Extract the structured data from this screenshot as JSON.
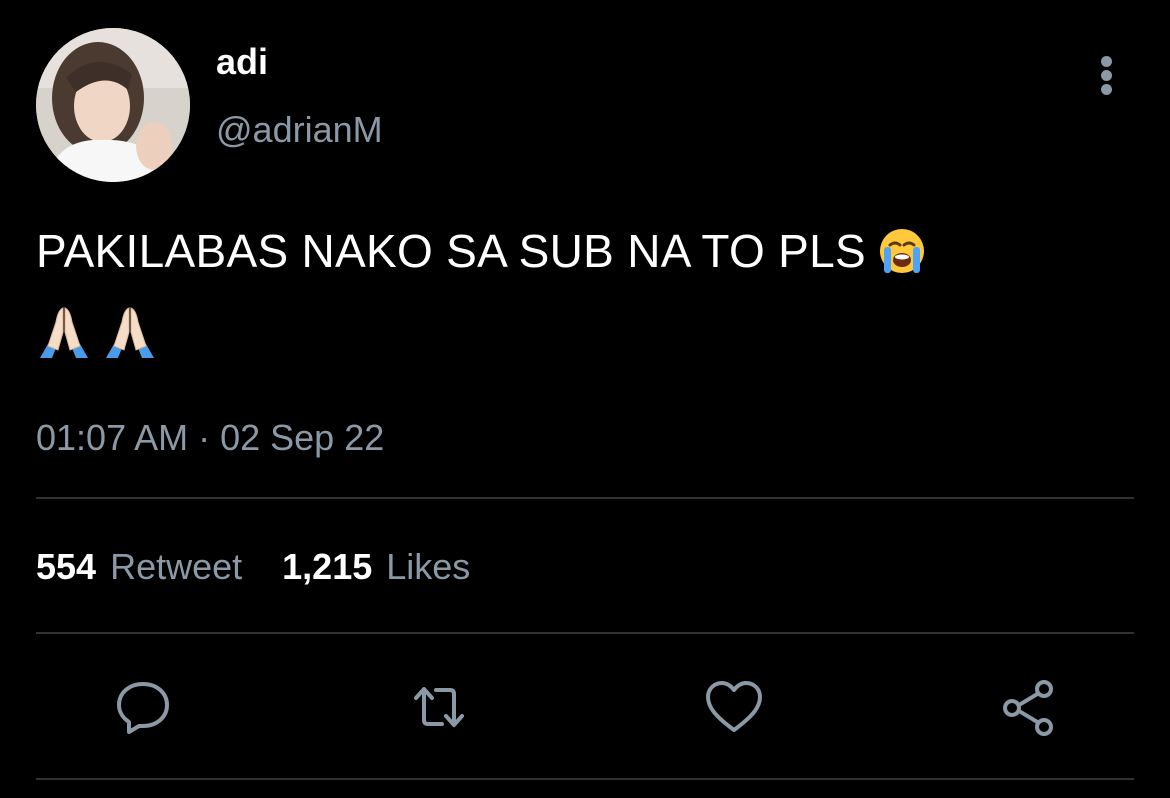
{
  "tweet": {
    "display_name": "adi",
    "handle": "@adrianM",
    "text": "PAKILABAS NAKO SA SUB NA TO PLS",
    "text_emoji": "loudly-crying-face",
    "second_line_emojis": [
      "folded-hands",
      "folded-hands"
    ],
    "timestamp": "01:07 AM · 02 Sep 22"
  },
  "stats": {
    "retweets_count": "554",
    "retweets_label": "Retweet",
    "likes_count": "1,215",
    "likes_label": "Likes"
  },
  "actions": [
    "reply-icon",
    "retweet-icon",
    "like-icon",
    "share-icon"
  ],
  "colors": {
    "background": "#000000",
    "primary_text": "#ffffff",
    "secondary_text": "#8b98a5",
    "divider": "#2f3336"
  }
}
